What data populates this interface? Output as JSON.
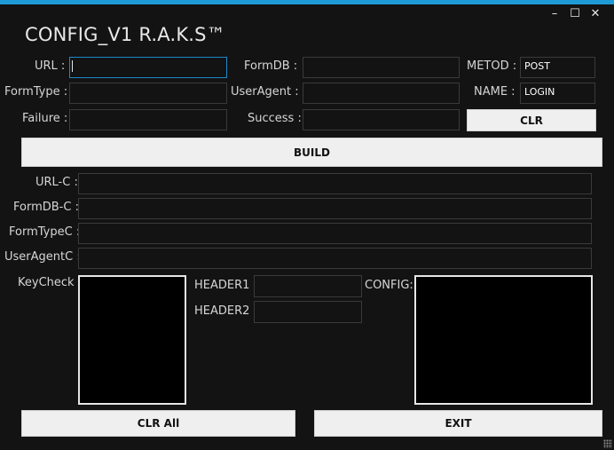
{
  "window": {
    "title": "CONFIG_V1 R.A.K.S™",
    "minimize_glyph": "–",
    "maximize_glyph": "☐",
    "close_glyph": "✕"
  },
  "form": {
    "url_label": "URL :",
    "url_value": "",
    "formtype_label": "FormType :",
    "formtype_value": "",
    "failure_label": "Failure :",
    "failure_value": "",
    "formdb_label": "FormDB :",
    "formdb_value": "",
    "useragent_label": "UserAgent :",
    "useragent_value": "",
    "success_label": "Success :",
    "success_value": "",
    "metod_label": "METOD :",
    "metod_value": "POST",
    "name_label": "NAME :",
    "name_value": "LOGIN",
    "clr_label": "CLR",
    "build_label": "BUILD"
  },
  "output": {
    "urlc_label": "URL-C :",
    "urlc_value": "",
    "formdbc_label": "FormDB-C :",
    "formdbc_value": "",
    "formtypec_label": "FormTypeC :",
    "formtypec_value": "",
    "useragentc_label": "UserAgentC :",
    "useragentc_value": "",
    "keycheck_label": "KeyCheck :",
    "header1_label": "HEADER1 :",
    "header1_value": "",
    "header2_label": "HEADER2 :",
    "header2_value": "",
    "config_label": "CONFIG:"
  },
  "footer": {
    "clr_all_label": "CLR All",
    "exit_label": "EXIT"
  },
  "colors": {
    "background": "#131313",
    "accent": "#1e9bd7",
    "button": "#efefef"
  }
}
